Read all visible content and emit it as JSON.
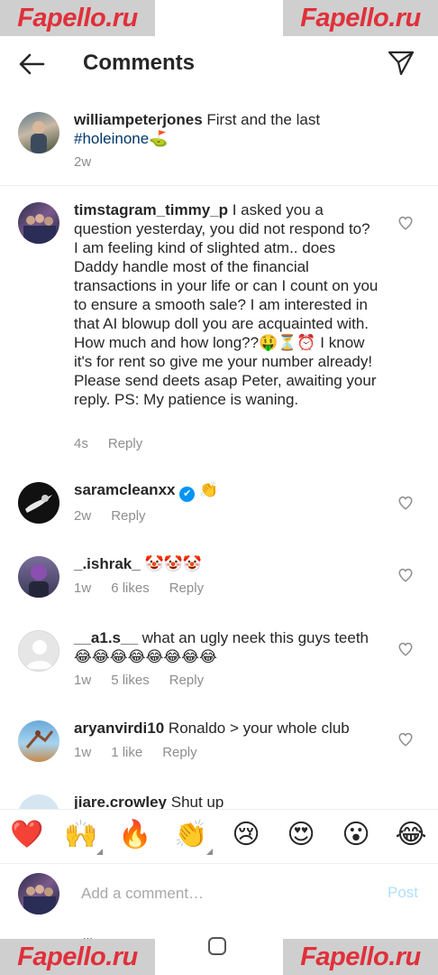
{
  "watermark": "Fapello.ru",
  "header": {
    "title": "Comments"
  },
  "caption": {
    "username": "williampeterjones",
    "text": " First and the last ",
    "hashtag": "#holeinone",
    "emoji": "⛳",
    "time": "2w"
  },
  "comments": [
    {
      "username": "timstagram_timmy_p",
      "text": " I asked you a question yesterday, you did not respond to? I am feeling kind of slighted atm.. does Daddy handle most of the financial transactions in your life or can I count on you to ensure a smooth sale? I am interested in that AI blowup doll you are acquainted with. How much and how long??🤑⏳⏰ I know it's for rent so give me your number already! Please send deets asap Peter, awaiting your reply. PS: My patience is waning.",
      "time": "4s",
      "reply": "Reply"
    },
    {
      "username": "saramcleanxx",
      "verified_badge": "✔",
      "text": " 👏",
      "time": "2w",
      "reply": "Reply"
    },
    {
      "username": "_.ishrak_",
      "text": " 🤡🤡🤡",
      "time": "1w",
      "likes": "6 likes",
      "reply": "Reply"
    },
    {
      "username": "__a1.s__",
      "text": " what an ugly neek this guys teeth 😂😂😂😂😂😂😂😂",
      "time": "1w",
      "likes": "5 likes",
      "reply": "Reply"
    },
    {
      "username": "aryanvirdi10",
      "text": " Ronaldo > your whole club",
      "time": "1w",
      "likes": "1 like",
      "reply": "Reply"
    },
    {
      "username": "jiare.crowley",
      "text": " Shut up"
    }
  ],
  "emoji_bar": [
    "❤️",
    "🙌",
    "🔥",
    "👏",
    "😢",
    "😍",
    "😮",
    "😂"
  ],
  "composer": {
    "placeholder": "Add a comment…",
    "post_label": "Post"
  },
  "colors": {
    "accent": "#0095f6",
    "post_disabled": "#b2dffc",
    "hashtag": "#00376b",
    "secondary_text": "#8e8e8e",
    "watermark": "#e0303a"
  }
}
